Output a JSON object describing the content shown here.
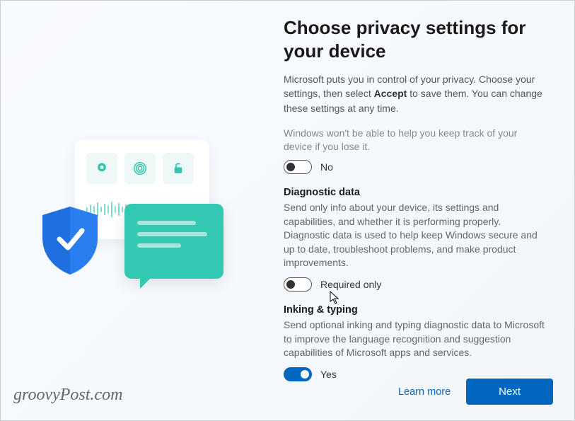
{
  "title": "Choose privacy settings for your device",
  "intro_a": "Microsoft puts you in control of your privacy. Choose your settings, then select ",
  "intro_bold": "Accept",
  "intro_b": " to save them. You can change these settings at any time.",
  "find_device": {
    "clip": "Windows won't be able to help you keep track of your device if you lose it.",
    "label": "No",
    "on": false
  },
  "diagnostic": {
    "heading": "Diagnostic data",
    "desc": "Send only info about your device, its settings and capabilities, and whether it is performing properly. Diagnostic data is used to help keep Windows secure and up to date, troubleshoot problems, and make product improvements.",
    "label": "Required only",
    "on": false
  },
  "inking": {
    "heading": "Inking & typing",
    "desc": "Send optional inking and typing diagnostic data to Microsoft to improve the language recognition and suggestion capabilities of Microsoft apps and services.",
    "label": "Yes",
    "on": true
  },
  "learn_more": "Learn more",
  "next": "Next",
  "watermark": "groovyPost.com"
}
